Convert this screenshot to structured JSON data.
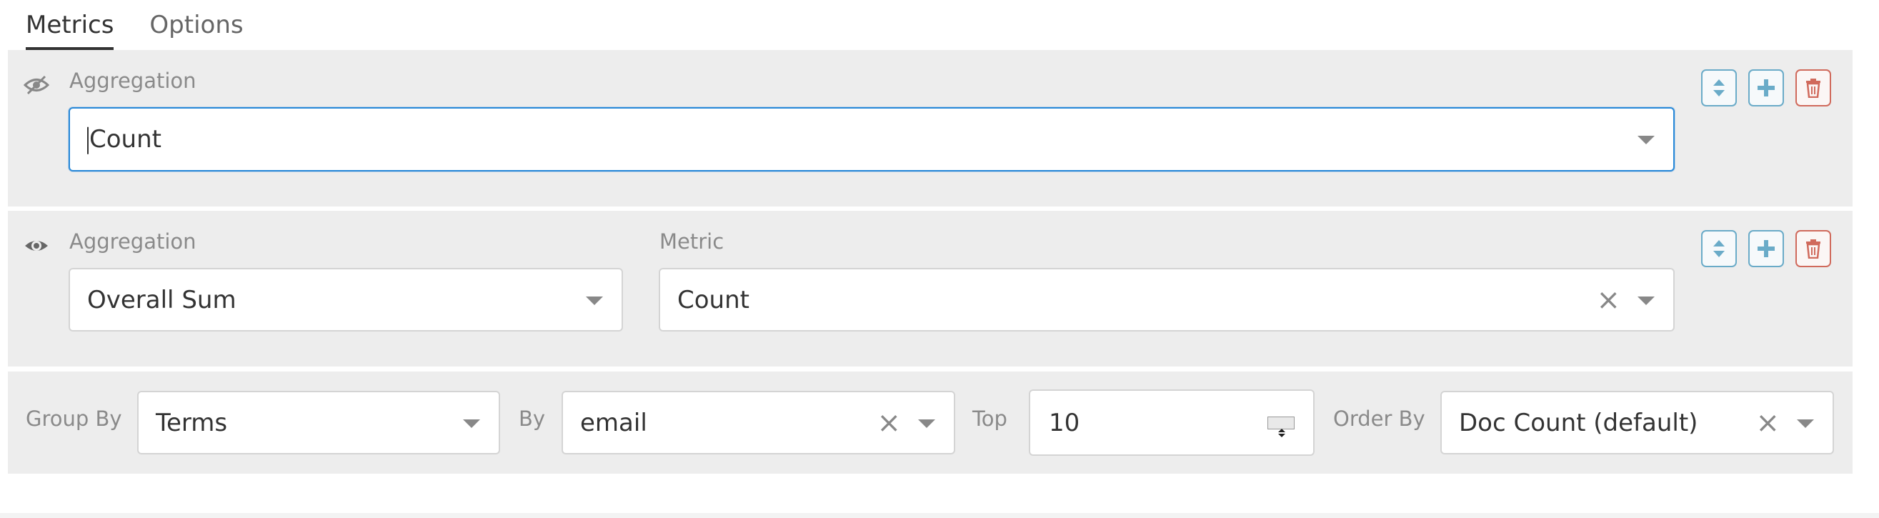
{
  "tabs": [
    {
      "label": "Metrics",
      "active": true
    },
    {
      "label": "Options",
      "active": false
    }
  ],
  "metric_1": {
    "aggregation_label": "Aggregation",
    "aggregation_value": "Count",
    "visibility": "hidden"
  },
  "metric_2": {
    "aggregation_label": "Aggregation",
    "aggregation_value": "Overall Sum",
    "metric_label": "Metric",
    "metric_value": "Count",
    "visibility": "visible"
  },
  "group": {
    "group_by_label": "Group By",
    "group_by_value": "Terms",
    "by_label": "By",
    "by_value": "email",
    "top_label": "Top",
    "top_value": "10",
    "order_by_label": "Order By",
    "order_by_value": "Doc Count (default)"
  },
  "icons": {
    "clear": "×",
    "reorder": "sort-icon",
    "add": "plus-icon",
    "delete": "trash-icon",
    "visibility": "eye-icon"
  },
  "colors": {
    "focus_border": "#2a89d8",
    "control_blue": "#6aabc8",
    "control_red": "#d06a5c",
    "panel_bg": "#ededed"
  }
}
